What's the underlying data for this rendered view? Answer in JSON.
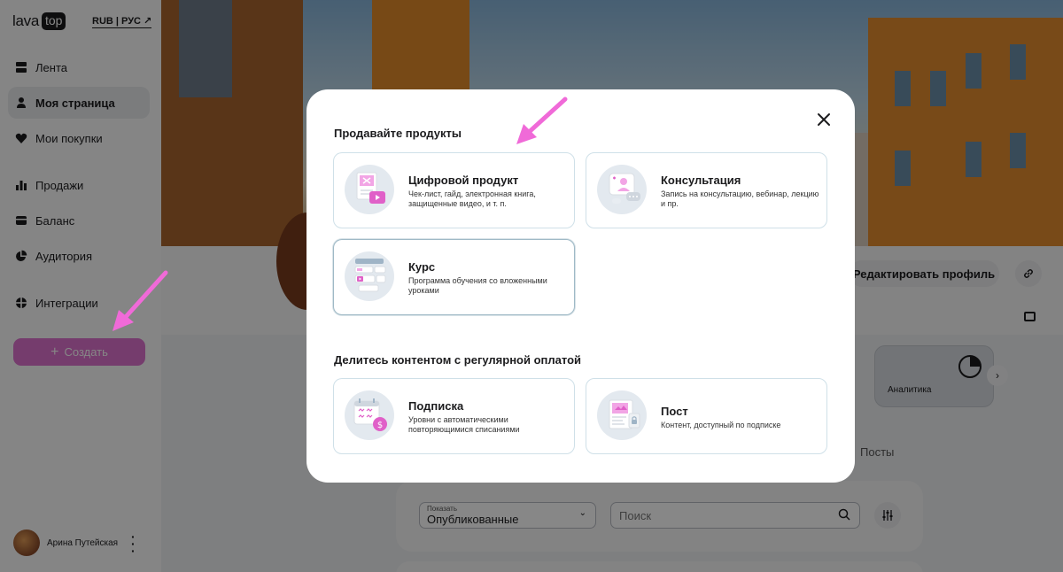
{
  "brand": {
    "logo_word": "lava",
    "logo_box": "top",
    "lang": "RUB | РУС ↗"
  },
  "sidebar": {
    "items": [
      {
        "label": "Лента",
        "icon": "feed-icon"
      },
      {
        "label": "Моя страница",
        "icon": "user-icon",
        "active": true
      },
      {
        "label": "Мои покупки",
        "icon": "heart-icon"
      },
      {
        "label": "Продажи",
        "icon": "bar-chart-icon"
      },
      {
        "label": "Баланс",
        "icon": "wallet-icon"
      },
      {
        "label": "Аудитория",
        "icon": "pie-chart-icon"
      },
      {
        "label": "Интеграции",
        "icon": "integrations-icon"
      }
    ],
    "create_label": "Создать",
    "user_name": "Арина Путейская"
  },
  "profile": {
    "edit_label": "Редактировать профиль",
    "analytics_label": "Аналитика",
    "posts_tab": "Посты"
  },
  "filters": {
    "show_label": "Показать",
    "show_value": "Опубликованные",
    "search_placeholder": "Поиск"
  },
  "modal": {
    "section1_title": "Продавайте продукты",
    "section2_title": "Делитесь контентом с регулярной оплатой",
    "cards": [
      {
        "title": "Цифровой продукт",
        "desc": "Чек-лист, гайд, электронная книга, защищенные видео, и т. п."
      },
      {
        "title": "Консультация",
        "desc": "Запись на консультацию, вебинар, лекцию и пр."
      },
      {
        "title": "Курс",
        "desc": "Программа обучения со вложенными уроками"
      },
      {
        "title": "Подписка",
        "desc": "Уровни с автоматическими повторяющимися списаниями"
      },
      {
        "title": "Пост",
        "desc": "Контент, доступный по подписке"
      }
    ]
  },
  "colors": {
    "accent": "#d64fc3",
    "annotation": "#f06ad8",
    "card_border": "#cfe0e8"
  }
}
